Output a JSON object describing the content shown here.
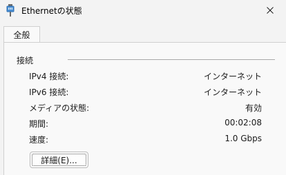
{
  "window": {
    "title": "Ethernetの状態",
    "icon": "ethernet-plug-icon",
    "close_icon": "close-icon"
  },
  "tabs": [
    {
      "label": "全般",
      "selected": true
    }
  ],
  "connection": {
    "group_title": "接続",
    "rows": [
      {
        "label": "IPv4 接続:",
        "value": "インターネット"
      },
      {
        "label": "IPv6 接続:",
        "value": "インターネット"
      },
      {
        "label": "メディアの状態:",
        "value": "有効"
      },
      {
        "label": "期間:",
        "value": "00:02:08"
      },
      {
        "label": "速度:",
        "value": "1.0 Gbps"
      }
    ],
    "details_button": "詳細(E)..."
  },
  "colors": {
    "window_bg": "#f3f3f3",
    "panel_bg": "#f9f9f9",
    "icon_accent": "#4a8fd4"
  }
}
